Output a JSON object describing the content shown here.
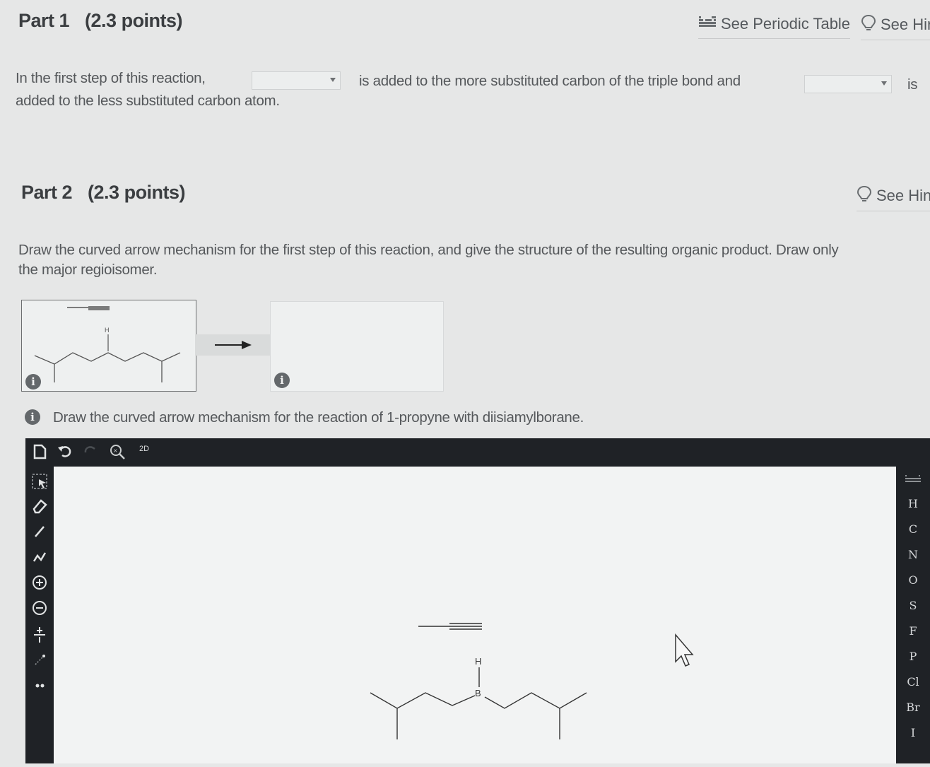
{
  "part1": {
    "title": "Part 1",
    "points": "(2.3 points)",
    "periodic_label": "See Periodic Table",
    "hint_label": "See Hir",
    "sentence_a": "In the first step of this reaction,",
    "sentence_b": "is added to the more substituted carbon of the triple bond and",
    "sentence_c": "is",
    "sentence_d": "added to the less substituted carbon atom.",
    "select1_value": "",
    "select2_value": ""
  },
  "part2": {
    "title": "Part 2",
    "points": "(2.3 points)",
    "hint_label": "See Hin",
    "instructions_line1": "Draw the curved arrow mechanism for the first step of this reaction, and give the structure of the resulting organic product. Draw only",
    "instructions_line2": "the major regioisomer.",
    "thumb_h": "H",
    "subprompt": "Draw the curved arrow mechanism for the reaction of 1-propyne with diisiamylborane.",
    "info_glyph": "i"
  },
  "editor": {
    "zoom_label": "2D",
    "elements": [
      "H",
      "C",
      "N",
      "O",
      "S",
      "F",
      "P",
      "Cl",
      "Br",
      "I"
    ],
    "atom_h": "H",
    "atom_b": "B"
  },
  "colors": {
    "background": "#e6e7e7",
    "toolbar": "#1f2226",
    "canvas": "#f2f3f3"
  }
}
